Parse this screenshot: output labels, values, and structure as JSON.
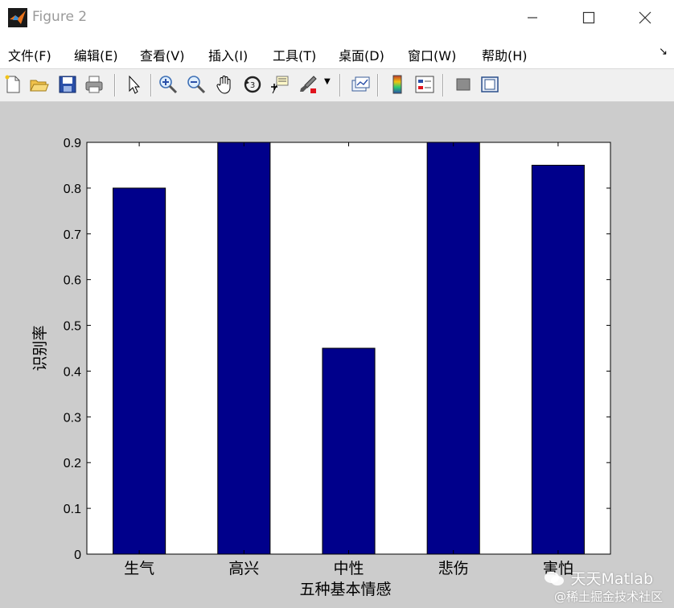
{
  "window": {
    "title": "Figure 2"
  },
  "menu": {
    "items": [
      "文件(F)",
      "编辑(E)",
      "查看(V)",
      "插入(I)",
      "工具(T)",
      "桌面(D)",
      "窗口(W)",
      "帮助(H)"
    ]
  },
  "toolbar": {
    "icons": [
      "new-figure-icon",
      "open-file-icon",
      "save-icon",
      "print-icon",
      "select-arrow-icon",
      "zoom-in-icon",
      "zoom-out-icon",
      "pan-hand-icon",
      "rotate-3d-icon",
      "data-cursor-icon",
      "brush-icon",
      "link-plot-icon",
      "colorbar-icon",
      "legend-icon",
      "hide-plot-tools-icon",
      "show-plot-tools-icon"
    ]
  },
  "colors": {
    "bar": "#00008b",
    "figure_bg": "#cccccc",
    "axes_bg": "#ffffff"
  },
  "chart_data": {
    "type": "bar",
    "categories": [
      "生气",
      "高兴",
      "中性",
      "悲伤",
      "害怕"
    ],
    "values": [
      0.8,
      0.9,
      0.45,
      0.9,
      0.85
    ],
    "xlabel": "五种基本情感",
    "ylabel": "识别率",
    "ylim": [
      0,
      0.9
    ],
    "yticks": [
      "0",
      "0.1",
      "0.2",
      "0.3",
      "0.4",
      "0.5",
      "0.6",
      "0.7",
      "0.8",
      "0.9"
    ],
    "grid": false
  },
  "watermark": {
    "line1": "天天Matlab",
    "line2": "@稀土掘金技术社区"
  }
}
